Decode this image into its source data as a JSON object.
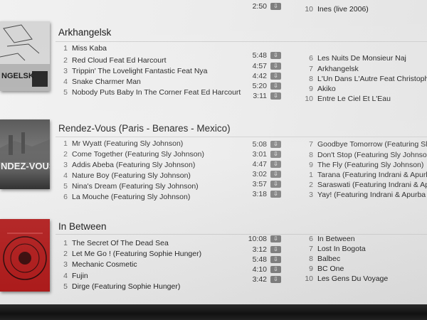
{
  "top_partial": {
    "left_duration": "2:50",
    "right_num": "10",
    "right_title": "Ines (live 2006)"
  },
  "albums": [
    {
      "title": "Arkhangelsk",
      "cover_text": "NGELSK",
      "left": [
        {
          "n": "1",
          "title": "Miss Kaba",
          "dur": ""
        },
        {
          "n": "2",
          "title": "Red Cloud Feat Ed Harcourt",
          "dur": "5:48"
        },
        {
          "n": "3",
          "title": "Trippin' The Lovelight Fantastic Feat Nya",
          "dur": "4:57"
        },
        {
          "n": "4",
          "title": "Snake Charmer Man",
          "dur": "4:42"
        },
        {
          "n": "5",
          "title": "Nobody Puts Baby In The Corner Feat Ed Harcourt",
          "dur": "5:20"
        }
      ],
      "extra_durations": [
        "3:11"
      ],
      "right": [
        {
          "n": "6",
          "title": "Les Nuits De Monsieur Naj"
        },
        {
          "n": "7",
          "title": "Arkhangelsk"
        },
        {
          "n": "8",
          "title": "L'Un Dans L'Autre Feat Christophe"
        },
        {
          "n": "9",
          "title": "Akiko"
        },
        {
          "n": "10",
          "title": "Entre Le Ciel Et L'Eau"
        }
      ]
    },
    {
      "title": "Rendez-Vous (Paris - Benares - Mexico)",
      "cover_text": "NDEZ-VOUS",
      "left": [
        {
          "n": "1",
          "title": "Mr Wyatt (Featuring Sly Johnson)",
          "dur": "5:08"
        },
        {
          "n": "2",
          "title": "Come Together (Featuring Sly Johnson)",
          "dur": "3:01"
        },
        {
          "n": "3",
          "title": "Addis Abeba (Featuring Sly Johnson)",
          "dur": "4:47"
        },
        {
          "n": "4",
          "title": "Nature Boy (Featuring Sly Johnson)",
          "dur": "3:02"
        },
        {
          "n": "5",
          "title": "Nina's Dream (Featuring Sly Johnson)",
          "dur": "3:57"
        },
        {
          "n": "6",
          "title": "La Mouche (Featuring Sly Johnson)",
          "dur": "3:18"
        }
      ],
      "right": [
        {
          "n": "7",
          "title": "Goodbye Tomorrow (Featuring Sly Johnson)"
        },
        {
          "n": "8",
          "title": "Don't Stop (Featuring Sly Johnson)"
        },
        {
          "n": "9",
          "title": "The Fly (Featuring Sly Johnson)"
        },
        {
          "n": "1",
          "title": "Tarana (Featuring Indrani & Apurba Mukherje"
        },
        {
          "n": "2",
          "title": "Saraswati (Featuring Indrani & Apurba Mukherj"
        },
        {
          "n": "3",
          "title": "Yay! (Featuring Indrani & Apurba Mukherjee)"
        }
      ]
    },
    {
      "title": "In Between",
      "left": [
        {
          "n": "1",
          "title": "The Secret Of The Dead Sea",
          "dur": "10:08"
        },
        {
          "n": "2",
          "title": "Let Me Go ! (Featuring Sophie Hunger)",
          "dur": "3:12"
        },
        {
          "n": "3",
          "title": "Mechanic Cosmetic",
          "dur": "5:48"
        },
        {
          "n": "4",
          "title": "Fujin",
          "dur": "4:10"
        },
        {
          "n": "5",
          "title": "Dirge (Featuring Sophie Hunger)",
          "dur": "3:42"
        }
      ],
      "right": [
        {
          "n": "6",
          "title": "In Between"
        },
        {
          "n": "7",
          "title": "Lost In Bogota"
        },
        {
          "n": "8",
          "title": "Balbec"
        },
        {
          "n": "9",
          "title": "BC One"
        },
        {
          "n": "10",
          "title": "Les Gens Du Voyage"
        }
      ]
    }
  ]
}
